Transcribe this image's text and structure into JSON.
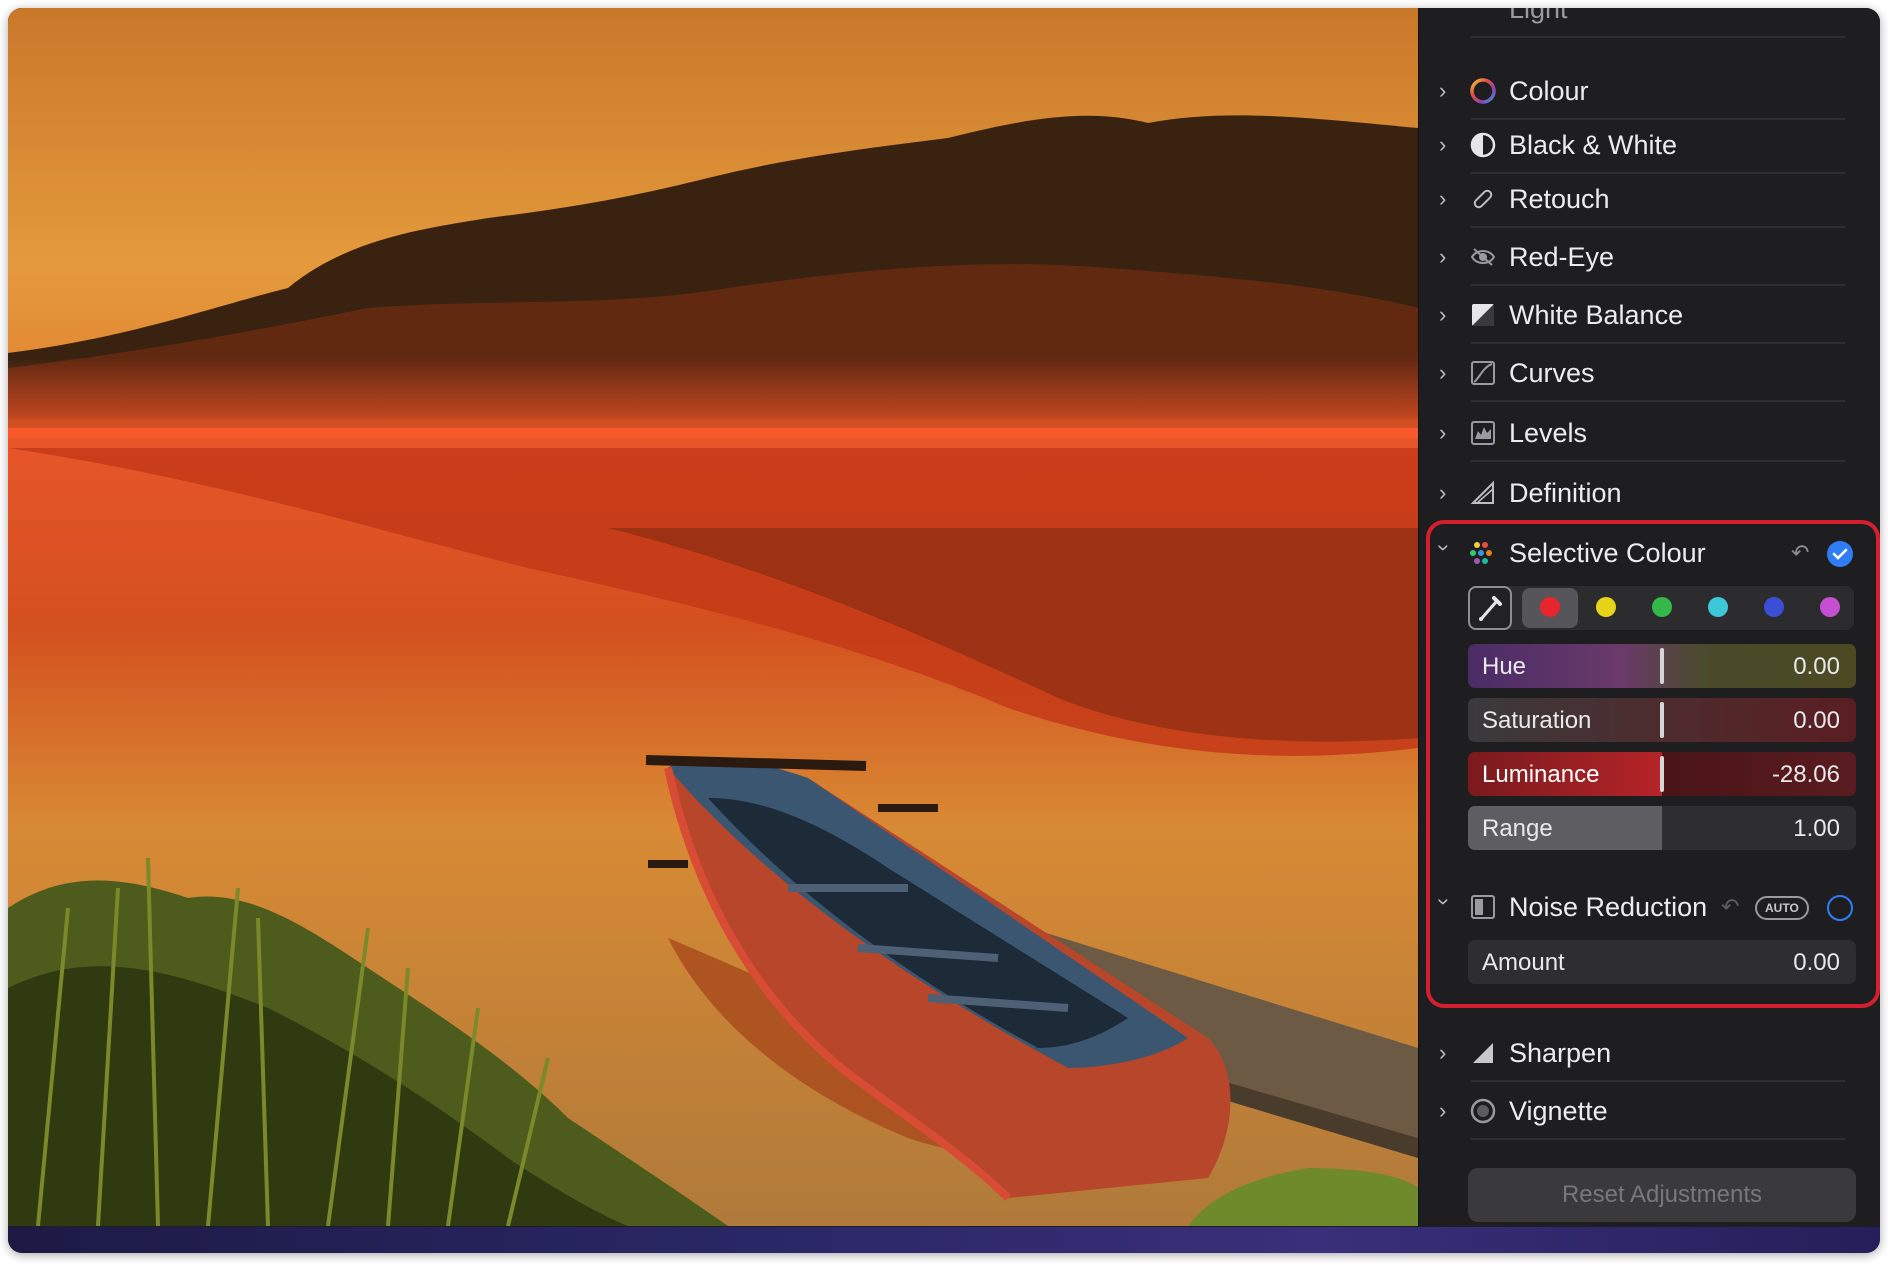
{
  "sidebar": {
    "partial_item_label": "Light",
    "items": [
      {
        "label": "Colour",
        "icon": "colour-ring-icon"
      },
      {
        "label": "Black & White",
        "icon": "half-circle-icon"
      },
      {
        "label": "Retouch",
        "icon": "bandage-icon"
      },
      {
        "label": "Red-Eye",
        "icon": "eye-icon"
      },
      {
        "label": "White Balance",
        "icon": "white-balance-icon"
      },
      {
        "label": "Curves",
        "icon": "curves-icon"
      },
      {
        "label": "Levels",
        "icon": "levels-icon"
      },
      {
        "label": "Definition",
        "icon": "triangle-outline-icon"
      }
    ],
    "bottom_items": [
      {
        "label": "Sharpen",
        "icon": "triangle-filled-icon"
      },
      {
        "label": "Vignette",
        "icon": "vignette-icon"
      }
    ]
  },
  "selective_colour": {
    "label": "Selective Colour",
    "enabled": true,
    "swatch_colors": [
      "#e8242c",
      "#e6d41a",
      "#34b84a",
      "#3ec7d8",
      "#3b4fd6",
      "#c44fd0"
    ],
    "selected_swatch": 0,
    "sliders": [
      {
        "name": "Hue",
        "value": "0.00"
      },
      {
        "name": "Saturation",
        "value": "0.00"
      },
      {
        "name": "Luminance",
        "value": "-28.06"
      },
      {
        "name": "Range",
        "value": "1.00"
      }
    ]
  },
  "noise_reduction": {
    "label": "Noise Reduction",
    "auto_label": "AUTO",
    "enabled": false,
    "amount_name": "Amount",
    "amount_value": "0.00"
  },
  "reset_button_label": "Reset Adjustments",
  "colors": {
    "highlight_border": "#d51f2e",
    "accent_blue": "#2f7cf6"
  }
}
